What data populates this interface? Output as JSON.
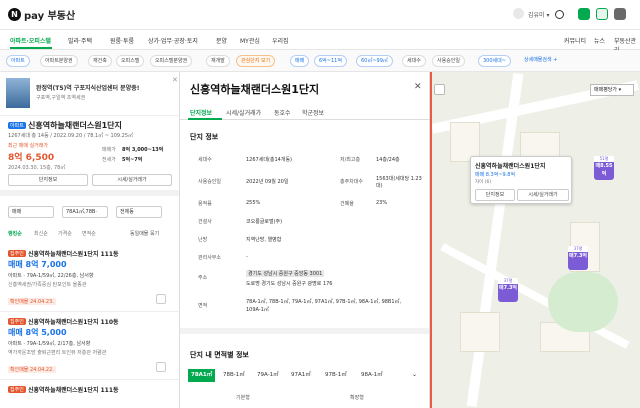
{
  "header": {
    "logo_text": "pay 부동산",
    "user": "김유미 ▾"
  },
  "nav": [
    "아파트·오피스텔",
    "빌라·주택",
    "원룸·투룸",
    "상가·업무·공장·토지",
    "분양",
    "MY관심",
    "우리집",
    "커뮤니티",
    "뉴스",
    "부동산관리"
  ],
  "filters": [
    "아파트",
    "아파트분양권",
    "재건축",
    "오피스텔",
    "오피스텔분양권",
    "재개발",
    "관심단지 보기",
    "매매",
    "6억~11억",
    "60㎡~99㎡",
    "세대수",
    "사용승인일",
    "300세대~",
    "상세매물검색 +"
  ],
  "left": {
    "ad": {
      "title": "완정역(T5)역 구포지식산업센터 분양중!",
      "sub": "구포역,구일역 초역세권",
      "close": "✕"
    },
    "complex": {
      "badge": "아파트",
      "name": "신흥역하늘채랜더스원1단지",
      "meta": "1267세대 총 14동 / 2022.09.20 / 78.1㎡ ~ 109.25㎡",
      "recent_label": "최근 매매 실거래가",
      "recent_price": "8억 6,500",
      "recent_sub": "2024.03.30, 15층, 78㎡",
      "sale_label": "매매가",
      "sale_value": "8억 3,000~13억",
      "lease_label": "전세가",
      "lease_value": "5억~7억",
      "btn_info": "단지정보",
      "btn_deal": "시세/실거래가"
    },
    "selects": [
      "매매",
      "78A1㎡,78B·",
      "전체동"
    ],
    "sort": {
      "active": "랭킹순",
      "options": [
        "최신순",
        "가격순",
        "면적순"
      ],
      "bundle": "동일매물 묶기"
    },
    "listings": [
      {
        "tag": "집주인",
        "title": "신흥역하늘채랜더스원1단지 111동",
        "price": "매매 8억 7,000",
        "spec": "아파트 · 79A-1/59㎡, 22/26층, 남서향",
        "desc": "신흥역세권/가족중심 탄포인트 올종관",
        "agent": "확인매물 24.04.23."
      },
      {
        "tag": "집주인",
        "title": "신흥역하늘채랜더스원1단지 111동",
        "price": "매매 8억 7,000",
        "spec": "아파트 · 79A-1/59㎡, 20/26층, 남서향",
        "desc": "신흥역세권/대형평/탑층 탄포인트 올종관",
        "agent": "확인매물 24.04.23"
      },
      {
        "tag": "집주인",
        "title": "신흥역하늘채랜더스원1단지 110동",
        "price": "매매 8억 5,000",
        "spec": "아파트 · 79A-1/59㎡, 2/17층, 남서향",
        "desc": "역가까운조망 출퇴근편리 트인뷰 저층관 저렴관",
        "agent": "확인매물 24.04.22."
      },
      {
        "tag": "집주인",
        "title": "신흥역하늘채랜더스원1단지 111동",
        "price": "",
        "spec": "",
        "desc": "",
        "agent": ""
      }
    ]
  },
  "middle": {
    "title": "신흥역하늘채랜더스원1단지",
    "tabs": [
      "단지정보",
      "시세/실거래가",
      "동호수",
      "학군정보"
    ],
    "section1": "단지 정보",
    "rows": [
      {
        "k": "세대수",
        "v": "1267세대(총14개동)",
        "k2": "저/최고층",
        "v2": "14층/24층"
      },
      {
        "k": "사용승인일",
        "v": "2022년 09월 20일",
        "k2": "총주차대수",
        "v2": "1563대(세대당 1.23대)"
      },
      {
        "k": "용적률",
        "v": "255%",
        "k2": "건폐율",
        "v2": "23%"
      },
      {
        "k": "건설사",
        "v": "코오롱글로벌(주)"
      },
      {
        "k": "난방",
        "v": "지역난방, 열병합"
      },
      {
        "k": "관리사무소",
        "v": "-"
      },
      {
        "k": "주소",
        "v": "경기도 성남시 중원구 중앙동 3001",
        "v2": "도로명 경기도 성남시 중원구 광명로 176"
      },
      {
        "k": "면적",
        "v": "78A-1㎡, 78B-1㎡, 79A-1㎡, 97A1㎡, 97B-1㎡, 98A-1㎡, 98B1㎡, 109A-1㎡"
      }
    ],
    "section2": "단지 내 면적별 정보",
    "area_tabs": [
      "78A1㎡",
      "78B-1㎡",
      "79A-1㎡",
      "97A1㎡",
      "97B-1㎡",
      "98A-1㎡"
    ],
    "bottom_labels": [
      "기본형",
      "확장형"
    ]
  },
  "map": {
    "select": "매매평당가 ▾",
    "popup": {
      "title": "신흥역하늘채랜더스원1단지",
      "price": "매매 8.3억~9.8억",
      "sub": "자이 (6)",
      "btn1": "단지정보",
      "btn2": "시세/실거래가"
    },
    "pins": [
      {
        "top": "51평",
        "mid": "매8.55억"
      },
      {
        "top": "37평",
        "mid": "매7.3억"
      },
      {
        "top": "37평",
        "mid": "매7.3억"
      }
    ]
  }
}
